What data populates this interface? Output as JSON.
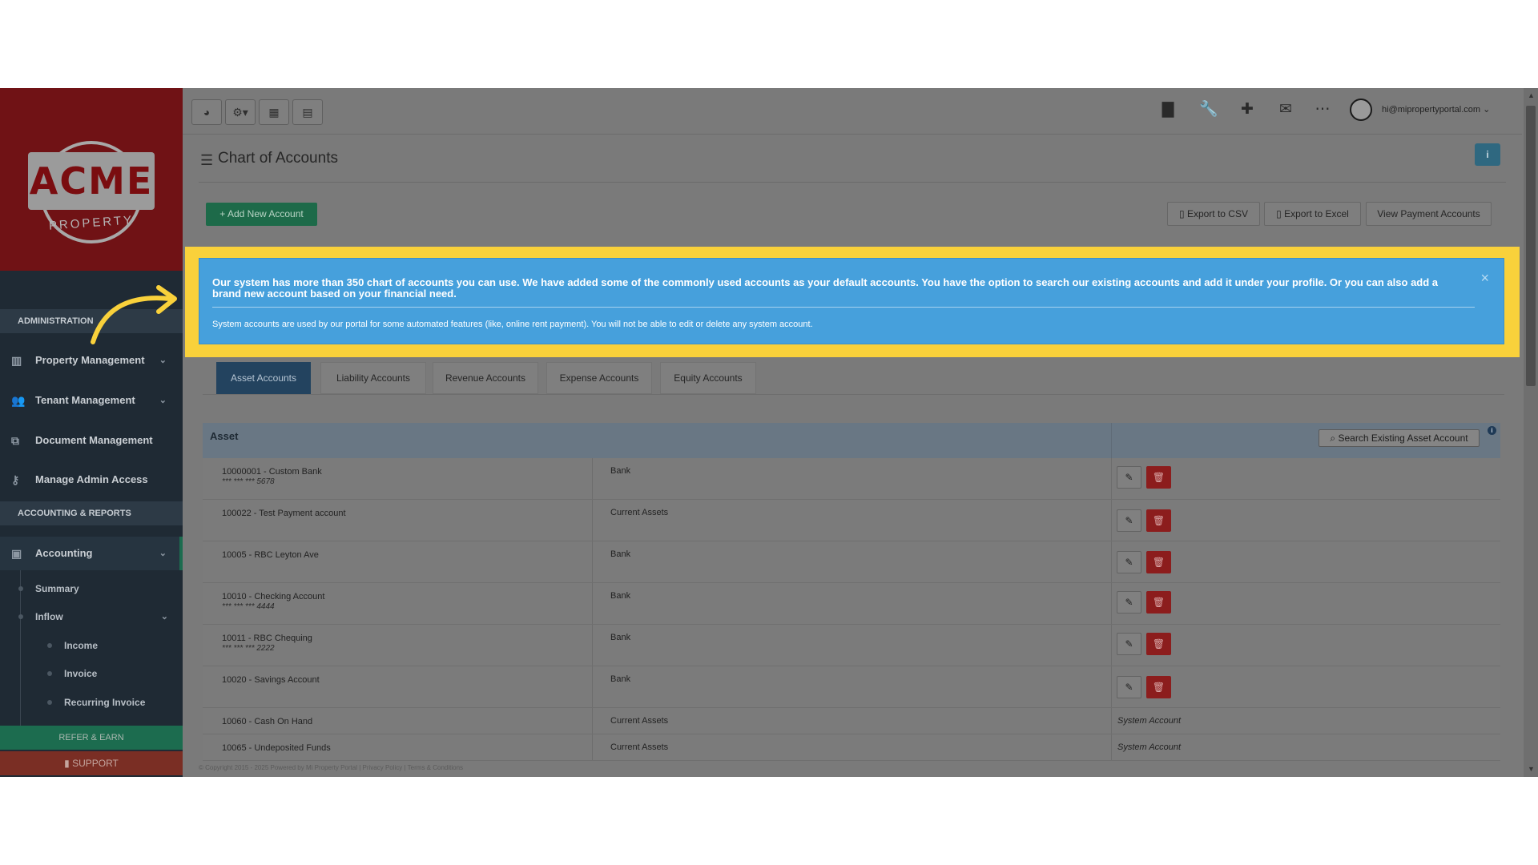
{
  "logo": {
    "brand": "ACME",
    "sub": "PROPERTY"
  },
  "sidebar": {
    "section_admin": "ADMINISTRATION",
    "section_accounting": "ACCOUNTING & REPORTS",
    "items": [
      {
        "label": "Property Management",
        "icon": "building-icon"
      },
      {
        "label": "Tenant Management",
        "icon": "users-icon"
      },
      {
        "label": "Document Management",
        "icon": "documents-icon"
      },
      {
        "label": "Manage Admin Access",
        "icon": "key-icon"
      },
      {
        "label": "Accounting",
        "icon": "money-icon"
      }
    ],
    "sub_items": {
      "summary": "Summary",
      "inflow": "Inflow",
      "income": "Income",
      "invoice": "Invoice",
      "recurring_invoice": "Recurring Invoice"
    },
    "refer": "REFER & EARN",
    "support": "SUPPORT"
  },
  "topbar": {
    "user_email": "hi@mipropertyportal.com"
  },
  "page": {
    "title": "Chart of Accounts",
    "add_button": "+ Add New Account",
    "export_csv": "Export to CSV",
    "export_excel": "Export to Excel",
    "view_payment": "View Payment Accounts"
  },
  "alert": {
    "main": "Our system has more than 350 chart of accounts you can use. We have added some of the commonly used accounts as your default accounts. You have the option to search our existing accounts and add it under your profile. Or you can also add a brand new account based on your financial need.",
    "sub": "System accounts are used by our portal for some automated features (like, online rent payment). You will not be able to edit or delete any system account.",
    "close": "×"
  },
  "tabs": [
    {
      "label": "Asset Accounts",
      "active": true
    },
    {
      "label": "Liability Accounts",
      "active": false
    },
    {
      "label": "Revenue Accounts",
      "active": false
    },
    {
      "label": "Expense Accounts",
      "active": false
    },
    {
      "label": "Equity Accounts",
      "active": false
    }
  ],
  "table": {
    "header": "Asset",
    "search_button": "Search Existing Asset Account",
    "rows": [
      {
        "name": "10000001 - Custom Bank",
        "mask": "*** *** *** 5678",
        "type": "Bank",
        "system": ""
      },
      {
        "name": "100022 - Test Payment account",
        "mask": "",
        "type": "Current Assets",
        "system": ""
      },
      {
        "name": "10005 - RBC Leyton Ave",
        "mask": "",
        "type": "Bank",
        "system": ""
      },
      {
        "name": "10010 - Checking Account",
        "mask": "*** *** *** 4444",
        "type": "Bank",
        "system": ""
      },
      {
        "name": "10011 - RBC Chequing",
        "mask": "*** *** *** 2222",
        "type": "Bank",
        "system": ""
      },
      {
        "name": "10020 - Savings Account",
        "mask": "",
        "type": "Bank",
        "system": ""
      },
      {
        "name": "10060 - Cash On Hand",
        "mask": "",
        "type": "Current Assets",
        "system": "System Account"
      },
      {
        "name": "10065 - Undeposited Funds",
        "mask": "",
        "type": "Current Assets",
        "system": "System Account"
      }
    ]
  },
  "footer": "© Copyright 2015 - 2025 Powered by Mi Property Portal | Privacy Policy | Terms & Conditions",
  "colors": {
    "alert": "#46a0dc",
    "highlight": "#f9d13b",
    "add": "#1d6a49",
    "delete": "#8c1d1d",
    "tab_active": "#23435f"
  }
}
